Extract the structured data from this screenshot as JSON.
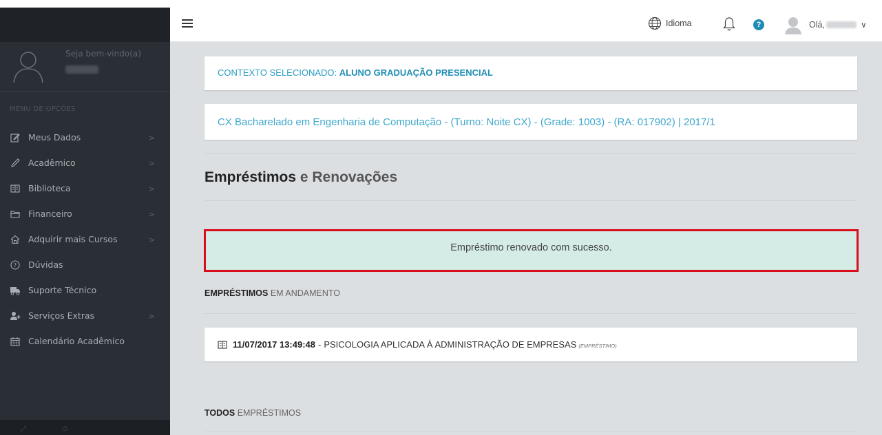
{
  "sidebar": {
    "welcome": "Seja bem-vindo(a)",
    "menu_header": "MENU DE OPÇÕES",
    "items": [
      {
        "label": "Meus Dados",
        "icon": "edit-icon",
        "has_submenu": true
      },
      {
        "label": "Acadêmico",
        "icon": "pencil-icon",
        "has_submenu": true
      },
      {
        "label": "Biblioteca",
        "icon": "book-icon",
        "has_submenu": true
      },
      {
        "label": "Financeiro",
        "icon": "folder-icon",
        "has_submenu": true
      },
      {
        "label": "Adquirir mais Cursos",
        "icon": "home-icon",
        "has_submenu": true
      },
      {
        "label": "Dúvidas",
        "icon": "question-circle-icon",
        "has_submenu": false
      },
      {
        "label": "Suporte Técnico",
        "icon": "truck-icon",
        "has_submenu": false
      },
      {
        "label": "Serviços Extras",
        "icon": "user-plus-icon",
        "has_submenu": true
      },
      {
        "label": "Calendário Acadêmico",
        "icon": "calendar-icon",
        "has_submenu": false
      }
    ],
    "chevron": ">"
  },
  "header": {
    "language_label": "Idioma",
    "greeting": "Olá,",
    "caret": "∨"
  },
  "context": {
    "prefix": "CONTEXTO SELECIONADO:",
    "value": "ALUNO GRADUAÇÃO PRESENCIAL"
  },
  "course": {
    "text": "CX Bacharelado em Engenharia de Computação - (Turno: Noite CX) - (Grade: 1003) - (RA: 017902) | 2017/1"
  },
  "page": {
    "title_bold": "Empréstimos",
    "title_rest": " e Renovações"
  },
  "alert": {
    "message": "Empréstimo renovado com sucesso."
  },
  "sections": {
    "ongoing_bold": "EMPRÉSTIMOS",
    "ongoing_rest": " EM ANDAMENTO",
    "all_bold": "TODOS",
    "all_rest": " EMPRÉSTIMOS"
  },
  "loans": [
    {
      "datetime": "11/07/2017 13:49:48",
      "separator": "-",
      "title": "PSICOLOGIA APLICADA À ADMINISTRAÇÃO DE EMPRESAS",
      "type": "(EMPRÉSTIMO)"
    }
  ],
  "colors": {
    "sidebar_bg": "#2a2f35",
    "accent": "#1f8fb6",
    "alert_bg": "#d5ece6",
    "alert_border": "#d70f1a",
    "content_bg": "#dcdfe2"
  }
}
